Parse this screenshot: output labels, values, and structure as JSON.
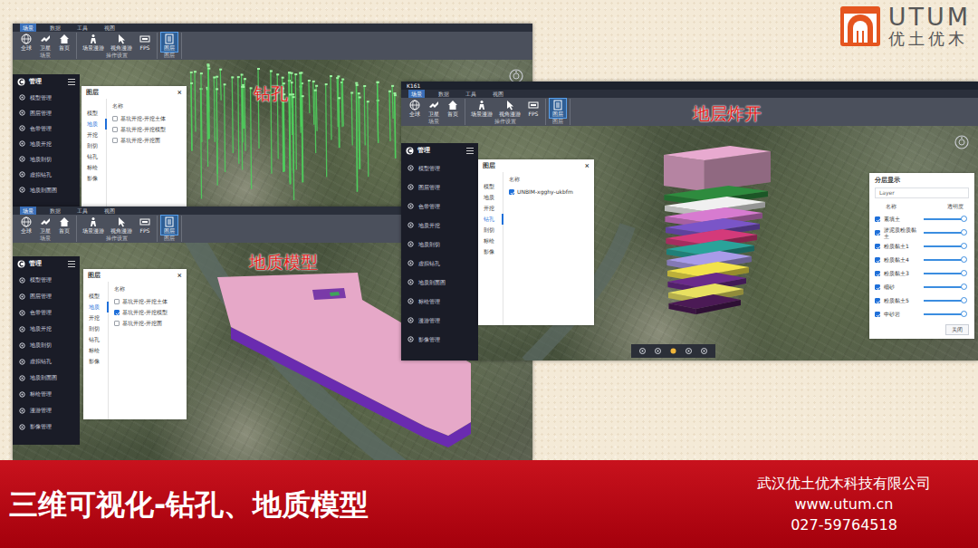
{
  "logo": {
    "mark": "UTUM",
    "subtitle": "优土优木"
  },
  "windows": [
    {
      "menu_tabs": [
        {
          "label": "场景",
          "selected": true
        },
        {
          "label": "数据",
          "selected": false
        },
        {
          "label": "工具",
          "selected": false
        },
        {
          "label": "视图",
          "selected": false
        }
      ],
      "toolbar": [
        {
          "caption": "场景",
          "items": [
            {
              "label": "全球",
              "selected": false
            },
            {
              "label": "卫星",
              "selected": false
            },
            {
              "label": "首页",
              "selected": false
            }
          ]
        },
        {
          "caption": "操作设置",
          "items": [
            {
              "label": "场景漫游",
              "selected": false
            },
            {
              "label": "视角漫游",
              "selected": false
            },
            {
              "label": "FPS",
              "selected": false
            }
          ]
        },
        {
          "caption": "图层",
          "items": [
            {
              "label": "图层",
              "selected": true
            }
          ]
        }
      ],
      "sidebar": {
        "title": "管理",
        "items": [
          {
            "label": "模型管理"
          },
          {
            "label": "图层管理"
          },
          {
            "label": "色带管理"
          },
          {
            "label": "地质开挖"
          },
          {
            "label": "地质剖切"
          },
          {
            "label": "虚拟钻孔"
          },
          {
            "label": "地质剖面图"
          }
        ]
      },
      "layer_panel": {
        "title": "图层",
        "close": "×",
        "categories": [
          {
            "label": "模型",
            "selected": false
          },
          {
            "label": "地质",
            "selected": true
          },
          {
            "label": "开挖",
            "selected": false
          },
          {
            "label": "剖切",
            "selected": false
          },
          {
            "label": "钻孔",
            "selected": false
          },
          {
            "label": "标绘",
            "selected": false
          },
          {
            "label": "影像",
            "selected": false
          }
        ],
        "column": "名称",
        "rows": [
          {
            "label": "基坑开挖-开挖土体",
            "checked": false
          },
          {
            "label": "基坑开挖-开挖模型",
            "checked": false
          },
          {
            "label": "基坑开挖-开挖面",
            "checked": false
          }
        ]
      },
      "caption": "钻孔",
      "figure": {
        "kind": "boreholes"
      }
    },
    {
      "menu_tabs": [
        {
          "label": "场景",
          "selected": true
        },
        {
          "label": "数据",
          "selected": false
        },
        {
          "label": "工具",
          "selected": false
        },
        {
          "label": "视图",
          "selected": false
        }
      ],
      "toolbar": [
        {
          "caption": "场景",
          "items": [
            {
              "label": "全球",
              "selected": false
            },
            {
              "label": "卫星",
              "selected": false
            },
            {
              "label": "首页",
              "selected": false
            }
          ]
        },
        {
          "caption": "操作设置",
          "items": [
            {
              "label": "场景漫游",
              "selected": false
            },
            {
              "label": "视角漫游",
              "selected": false
            },
            {
              "label": "FPS",
              "selected": false
            }
          ]
        },
        {
          "caption": "图层",
          "items": [
            {
              "label": "图层",
              "selected": true
            }
          ]
        }
      ],
      "sidebar": {
        "title": "管理",
        "items": [
          {
            "label": "模型管理"
          },
          {
            "label": "图层管理"
          },
          {
            "label": "色带管理"
          },
          {
            "label": "地质开挖"
          },
          {
            "label": "地质剖切"
          },
          {
            "label": "虚拟钻孔"
          },
          {
            "label": "地质剖面图"
          },
          {
            "label": "标绘管理"
          },
          {
            "label": "漫游管理"
          },
          {
            "label": "影像管理"
          }
        ]
      },
      "layer_panel": {
        "title": "图层",
        "close": "×",
        "categories": [
          {
            "label": "模型",
            "selected": false
          },
          {
            "label": "地质",
            "selected": true
          },
          {
            "label": "开挖",
            "selected": false
          },
          {
            "label": "剖切",
            "selected": false
          },
          {
            "label": "钻孔",
            "selected": false
          },
          {
            "label": "标绘",
            "selected": false
          },
          {
            "label": "影像",
            "selected": false
          }
        ],
        "column": "名称",
        "rows": [
          {
            "label": "基坑开挖-开挖土体",
            "checked": false
          },
          {
            "label": "基坑开挖-开挖模型",
            "checked": true
          },
          {
            "label": "基坑开挖-开挖面",
            "checked": false
          }
        ]
      },
      "caption": "地质模型",
      "figure": {
        "kind": "model"
      }
    },
    {
      "title": "K161",
      "menu_tabs": [
        {
          "label": "场景",
          "selected": true
        },
        {
          "label": "数据",
          "selected": false
        },
        {
          "label": "工具",
          "selected": false
        },
        {
          "label": "视图",
          "selected": false
        }
      ],
      "toolbar": [
        {
          "caption": "场景",
          "items": [
            {
              "label": "全球",
              "selected": false
            },
            {
              "label": "卫星",
              "selected": false
            },
            {
              "label": "首页",
              "selected": false
            }
          ]
        },
        {
          "caption": "操作设置",
          "items": [
            {
              "label": "场景漫游",
              "selected": false
            },
            {
              "label": "视角漫游",
              "selected": false
            },
            {
              "label": "FPS",
              "selected": false
            }
          ]
        },
        {
          "caption": "图层",
          "items": [
            {
              "label": "图层",
              "selected": true
            }
          ]
        }
      ],
      "sidebar": {
        "title": "管理",
        "items": [
          {
            "label": "模型管理"
          },
          {
            "label": "图层管理"
          },
          {
            "label": "色带管理"
          },
          {
            "label": "地质开挖"
          },
          {
            "label": "地质剖切"
          },
          {
            "label": "虚拟钻孔"
          },
          {
            "label": "地质剖面图"
          },
          {
            "label": "标绘管理"
          },
          {
            "label": "漫游管理"
          },
          {
            "label": "影像管理"
          }
        ]
      },
      "layer_panel": {
        "title": "图层",
        "close": "×",
        "categories": [
          {
            "label": "模型",
            "selected": false
          },
          {
            "label": "地质",
            "selected": false
          },
          {
            "label": "开挖",
            "selected": false
          },
          {
            "label": "钻孔",
            "selected": true
          },
          {
            "label": "剖切",
            "selected": false
          },
          {
            "label": "标绘",
            "selected": false
          },
          {
            "label": "影像",
            "selected": false
          }
        ],
        "column": "名称",
        "rows": [
          {
            "label": "UNBIM-xgghy-ukbfm",
            "checked": true
          }
        ]
      },
      "caption": "地层炸开",
      "figure": {
        "kind": "strata",
        "layers": [
          {
            "color": "#e8aad0"
          },
          {
            "color": "#2e8b3e"
          },
          {
            "color": "#f0f0f0"
          },
          {
            "color": "#d77bd0"
          },
          {
            "color": "#7a55c8"
          },
          {
            "color": "#d43a7a"
          },
          {
            "color": "#2aa39a"
          },
          {
            "color": "#a99be8"
          },
          {
            "color": "#f2e24a"
          },
          {
            "color": "#6a2a8a"
          },
          {
            "color": "#e8e060"
          },
          {
            "color": "#4b1a55"
          }
        ]
      },
      "strata_panel": {
        "title": "分层显示",
        "field": "Layer",
        "columns": [
          "名称",
          "透明度"
        ],
        "rows": [
          {
            "label": "素填土",
            "checked": true,
            "level": 0.97
          },
          {
            "label": "淤泥质粉质黏土",
            "checked": true,
            "level": 0.97
          },
          {
            "label": "粉质黏土1",
            "checked": true,
            "level": 0.97
          },
          {
            "label": "粉质黏土4",
            "checked": true,
            "level": 0.97
          },
          {
            "label": "粉质黏土3",
            "checked": true,
            "level": 0.97
          },
          {
            "label": "细砂",
            "checked": true,
            "level": 0.97
          },
          {
            "label": "粉质黏土5",
            "checked": true,
            "level": 0.97
          },
          {
            "label": "中砂岩",
            "checked": true,
            "level": 0.97
          }
        ],
        "button": "关闭"
      }
    }
  ],
  "banner": {
    "title": "三维可视化-钻孔、地质模型",
    "company": "武汉优土优木科技有限公司",
    "url": "www.utum.cn",
    "phone": "027-59764518"
  }
}
